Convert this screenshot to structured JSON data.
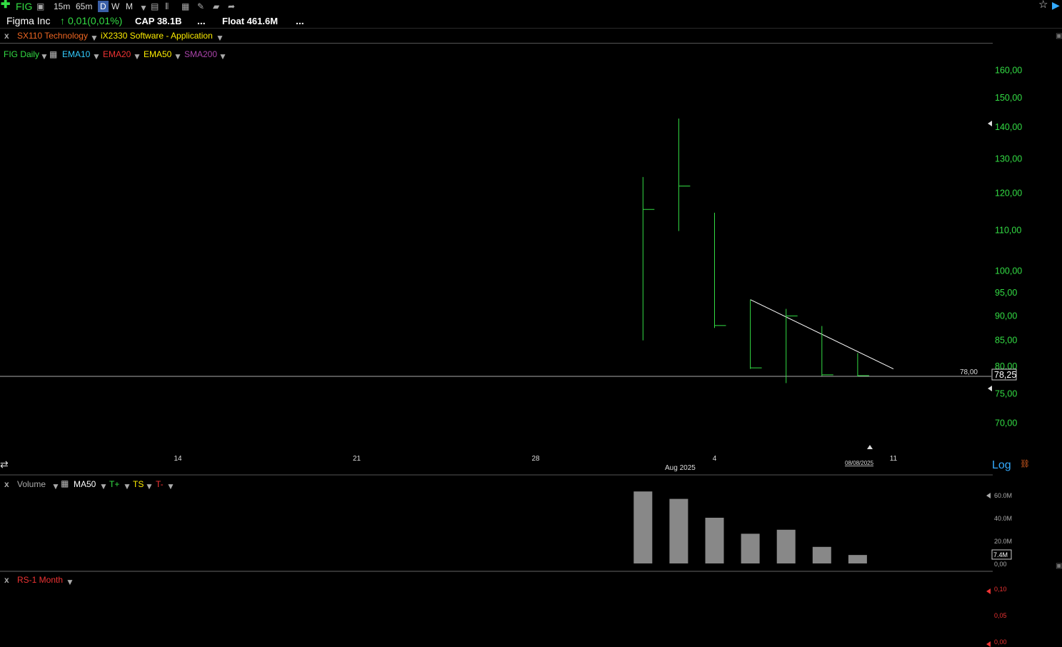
{
  "toolbar": {
    "add_icon": "plus-icon",
    "symbol": "FIG",
    "intervals": [
      "15m",
      "65m",
      "D",
      "W",
      "M"
    ],
    "active_interval": "D"
  },
  "info": {
    "company": "Figma Inc",
    "change": "0,01(0,01%)",
    "cap": "CAP 38.1B",
    "ellipsis1": "...",
    "float": "Float 461.6M",
    "ellipsis2": "..."
  },
  "sector": {
    "close": "x",
    "sector": "SX110 Technology",
    "industry": "iX2330 Software - Application"
  },
  "indicators": {
    "chart_name": "FIG Daily",
    "ema10": "EMA10",
    "ema20": "EMA20",
    "ema50": "EMA50",
    "sma200": "SMA200"
  },
  "colors": {
    "bar": "#33dd44",
    "ema10": "#33ccff",
    "ema20": "#ee3333",
    "ema50": "#ffee00",
    "sma200": "#aa44aa",
    "volume": "#888888"
  },
  "price_axis": {
    "ticks": [
      "160,00",
      "150,00",
      "140,00",
      "130,00",
      "120,00",
      "110,00",
      "100,00",
      "95,00",
      "90,00",
      "85,00",
      "80,00",
      "75,00",
      "70,00"
    ],
    "hline_label": "78,00",
    "last_price": "78,25",
    "log_label": "Log"
  },
  "date_axis": {
    "ticks": [
      "14",
      "21",
      "28",
      "4",
      "11"
    ],
    "month_label": "Aug 2025",
    "cursor_date": "08/08/2025"
  },
  "chart_data": [
    {
      "type": "ohlc",
      "title": "FIG Daily",
      "scale": "log",
      "categories": [
        "2025-07-31",
        "2025-08-01",
        "2025-08-04",
        "2025-08-05",
        "2025-08-06",
        "2025-08-07",
        "2025-08-08"
      ],
      "high": [
        124.6,
        142.9,
        114.6,
        93.5,
        91.5,
        87.9,
        82.5
      ],
      "low": [
        85.0,
        109.8,
        87.5,
        79.5,
        76.9,
        78.2,
        78.1
      ],
      "close": [
        115.5,
        122.0,
        88.0,
        79.7,
        90.0,
        78.4,
        78.25
      ],
      "hline": 78.0,
      "trendline": [
        {
          "date": "2025-08-05",
          "price": 93.5
        },
        {
          "date": "2025-08-11",
          "price": 79.5
        }
      ],
      "ylim": [
        68,
        165
      ]
    },
    {
      "type": "bar",
      "title": "Volume",
      "categories": [
        "2025-07-31",
        "2025-08-01",
        "2025-08-04",
        "2025-08-05",
        "2025-08-06",
        "2025-08-07",
        "2025-08-08"
      ],
      "values": [
        63.0,
        56.5,
        40.0,
        26.0,
        29.5,
        14.5,
        7.4
      ],
      "unit": "M",
      "ticks": [
        "60.0M",
        "40.0M",
        "20.0M",
        "0,00"
      ],
      "last_value": "7.4M",
      "ylim": [
        0,
        65
      ]
    },
    {
      "type": "line",
      "title": "RS-1 Month",
      "ticks": [
        "0,10",
        "0,05",
        "0,00"
      ],
      "ylim": [
        0,
        0.1
      ],
      "values": []
    }
  ],
  "volume_panel": {
    "close": "x",
    "title": "Volume",
    "ma": "MA50",
    "tplus": "T+",
    "ts": "TS",
    "tminus": "T-"
  },
  "rs_panel": {
    "close": "x",
    "title": "RS-1 Month"
  }
}
